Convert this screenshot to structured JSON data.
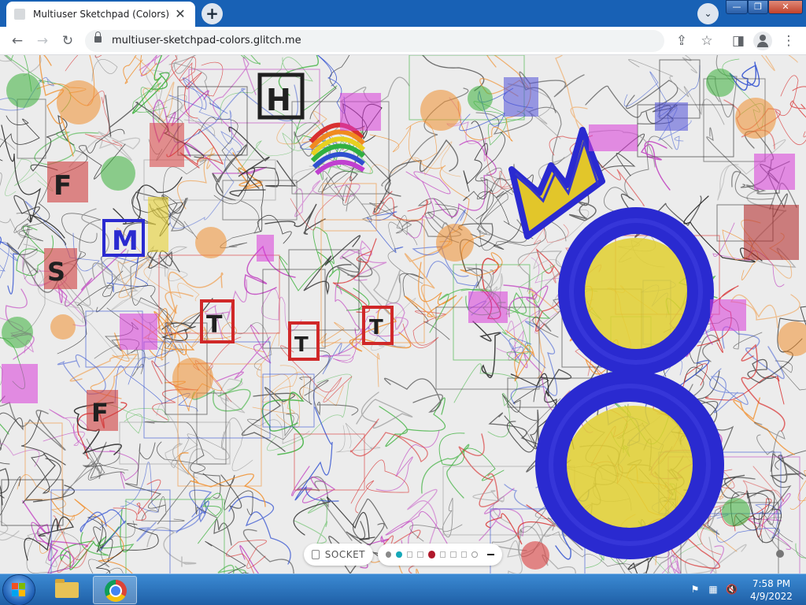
{
  "browser": {
    "tab_title": "Multiuser Sketchpad (Colors)",
    "tab_close": "✕",
    "new_tab": "+",
    "tab_search": "⌄",
    "url": "multiuser-sketchpad-colors.glitch.me",
    "window_controls": {
      "minimize": "—",
      "maximize": "❐",
      "close": "✕"
    },
    "nav": {
      "back": "←",
      "forward": "→",
      "reload": "↻"
    },
    "toolbar_icons": {
      "share": "⇪",
      "bookmark": "☆",
      "side_panel": "◨",
      "menu": "⋮"
    }
  },
  "sketchpad": {
    "socket_label": "SOCKET",
    "colors": [
      {
        "name": "gray",
        "hex": "#8a8a8a",
        "shape": "dot"
      },
      {
        "name": "teal",
        "hex": "#16a8b8",
        "shape": "dot"
      },
      {
        "name": "empty-1",
        "hex": "#ffffff",
        "shape": "square"
      },
      {
        "name": "empty-2",
        "hex": "#ffffff",
        "shape": "square"
      },
      {
        "name": "red",
        "hex": "#b0182a",
        "shape": "dot",
        "selected": true
      },
      {
        "name": "empty-3",
        "hex": "#ffffff",
        "shape": "square"
      },
      {
        "name": "empty-4",
        "hex": "#ffffff",
        "shape": "square"
      },
      {
        "name": "empty-5",
        "hex": "#ffffff",
        "shape": "square"
      },
      {
        "name": "white",
        "hex": "#ffffff",
        "shape": "dot"
      }
    ],
    "pen_icon": "pen-width-line-icon"
  },
  "taskbar": {
    "apps": [
      "windows-explorer",
      "google-chrome"
    ],
    "tray": {
      "flag": "⚑",
      "network": "▦",
      "volume": "🔇"
    },
    "clock_time": "7:58 PM",
    "clock_date": "4/9/2022"
  },
  "colors": {
    "titlebar": "#1861b5",
    "taskbar": "#2a6fbf",
    "canvas_bg": "#ececec",
    "ink_blue": "#2a2ad0",
    "ink_yellow": "#e8d020",
    "ink_magenta": "#d83ad8",
    "ink_orange": "#f0902a",
    "ink_red": "#d02828",
    "ink_green": "#3ac03a"
  }
}
